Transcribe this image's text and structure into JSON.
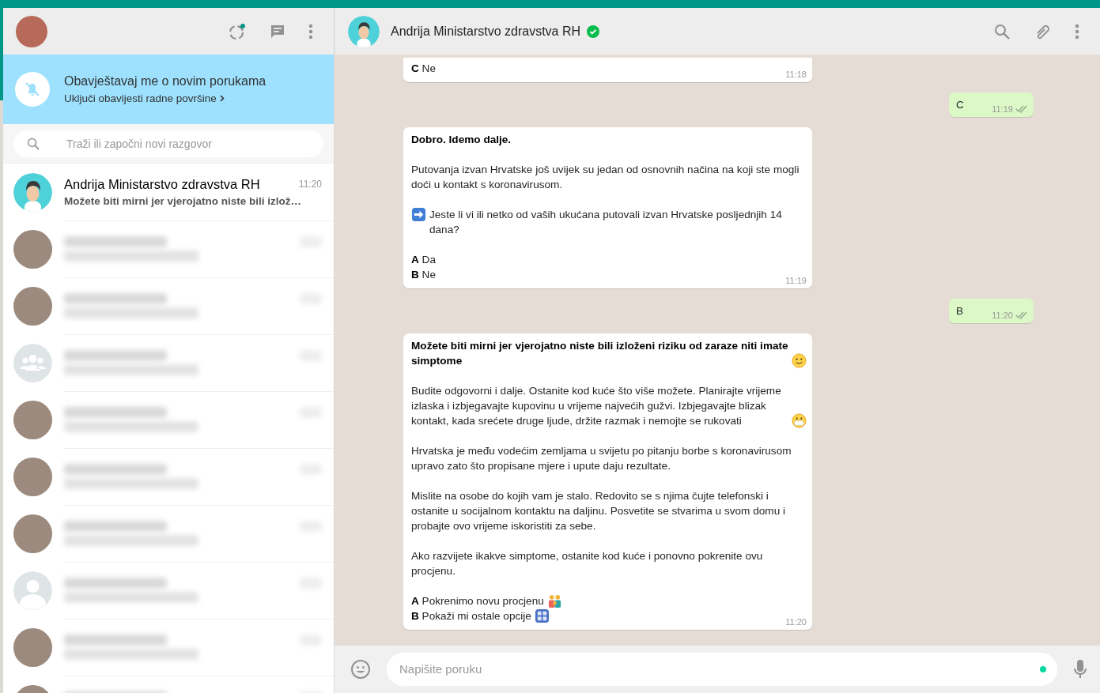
{
  "sidebar": {
    "notification": {
      "title": "Obavještavaj me o novim porukama",
      "link": "Uključi obavijesti radne površine"
    },
    "search": {
      "placeholder": "Traži ili započni novi razgovor"
    },
    "chats": [
      {
        "kind": "visible",
        "avatar": {
          "kind": "cartoon"
        },
        "name": "Andrija Ministarstvo zdravstva RH",
        "time": "11:20",
        "preview": "Možete biti mirni jer vjerojatno niste bili izlož…"
      },
      {
        "kind": "blurred",
        "avatar": {
          "kind": "photo"
        }
      },
      {
        "kind": "blurred",
        "avatar": {
          "kind": "photo"
        }
      },
      {
        "kind": "blurred",
        "avatar": {
          "kind": "group"
        }
      },
      {
        "kind": "blurred",
        "avatar": {
          "kind": "photo"
        }
      },
      {
        "kind": "blurred",
        "avatar": {
          "kind": "photo"
        }
      },
      {
        "kind": "blurred",
        "avatar": {
          "kind": "photo"
        }
      },
      {
        "kind": "blurred",
        "avatar": {
          "kind": "person"
        }
      },
      {
        "kind": "blurred",
        "avatar": {
          "kind": "photo"
        }
      },
      {
        "kind": "blurred",
        "avatar": {
          "kind": "photo"
        }
      }
    ]
  },
  "conversation": {
    "name": "Andrija Ministarstvo zdravstva RH",
    "verified": true,
    "messages": [
      {
        "kind": "in",
        "cut": true,
        "time": "11:18",
        "paragraphs": [
          [
            {
              "text": "**C** Ne"
            }
          ]
        ]
      },
      {
        "kind": "out",
        "time": "11:19",
        "read": false,
        "paragraphs": [
          [
            {
              "text": "C"
            }
          ]
        ]
      },
      {
        "kind": "in",
        "time": "11:19",
        "paragraphs": [
          [
            {
              "text": "Dobro. Idemo dalje.",
              "bold": true
            }
          ],
          [
            {
              "text": "Putovanja izvan Hrvatske još uvijek su jedan od osnovnih načina na koji ste mogli doći u kontakt s koronavirusom."
            }
          ],
          [
            {
              "text": "Jeste li vi ili netko od vaših ukućana putovali izvan Hrvatske posljednjih 14 dana?",
              "icon_before": {
                "kind": "arrow"
              }
            }
          ],
          [
            {
              "text": "**A** Da"
            },
            {
              "text": "**B** Ne"
            }
          ]
        ]
      },
      {
        "kind": "out",
        "time": "11:20",
        "read": false,
        "paragraphs": [
          [
            {
              "text": "B"
            }
          ]
        ]
      },
      {
        "kind": "in",
        "time": "11:20",
        "paragraphs": [
          [
            {
              "text": "Možete biti mirni jer vjerojatno niste bili izloženi riziku od zaraze niti imate simptome",
              "bold": true,
              "icon_after": {
                "kind": "smile"
              }
            }
          ],
          [
            {
              "text": "Budite odgovorni i dalje. Ostanite kod kuće što više možete. Planirajte vrijeme izlaska i izbjegavajte kupovinu u vrijeme najvećih gužvi. Izbjegavajte blizak kontakt, kada srećete druge ljude, držite razmak i nemojte se rukovati",
              "icon_after": {
                "kind": "mask"
              }
            }
          ],
          [
            {
              "text": "Hrvatska je među vodećim zemljama u svijetu po pitanju borbe s koronavirusom upravo zato što propisane mjere i upute daju rezultate."
            }
          ],
          [
            {
              "text": "Mislite na osobe do kojih vam je stalo. Redovito se s njima čujte telefonski i ostanite u socijalnom kontaktu na daljinu. Posvetite se stvarima u svom domu i probajte ovo vrijeme iskoristiti za sebe."
            }
          ],
          [
            {
              "text": "Ako razvijete ikakve simptome, ostanite kod kuće i ponovno pokrenite ovu procjenu."
            }
          ],
          [
            {
              "text": "**A** Pokrenimo novu procjenu",
              "icon_after": {
                "kind": "family"
              }
            },
            {
              "text": "**B** Pokaži mi ostale opcije",
              "icon_after": {
                "kind": "blocks"
              }
            }
          ]
        ]
      }
    ]
  },
  "composer": {
    "placeholder": "Napišite poruku"
  }
}
